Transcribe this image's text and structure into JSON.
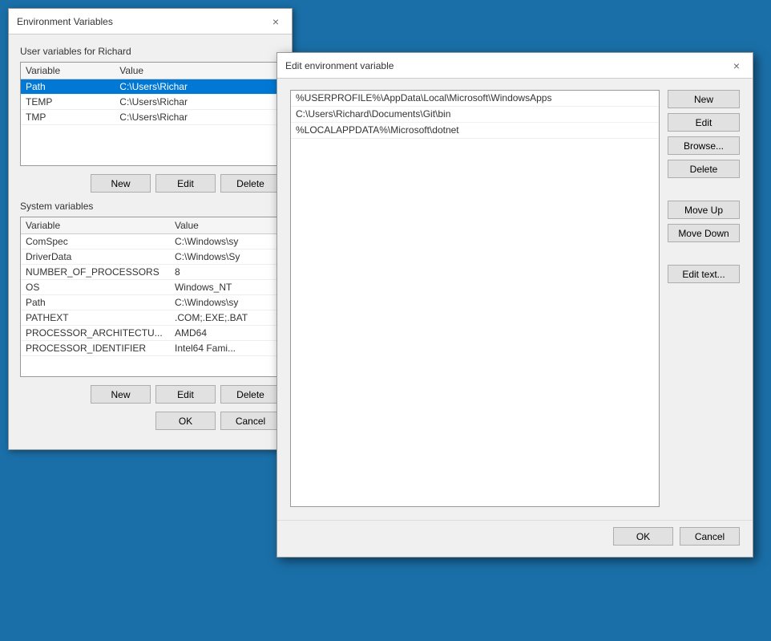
{
  "desktop": {
    "background_color": "#1a6fa8"
  },
  "env_dialog": {
    "title": "Environment Variables",
    "close_label": "×",
    "user_section_label": "User variables for Richard",
    "user_table": {
      "headers": [
        "Variable",
        "Value"
      ],
      "rows": [
        {
          "variable": "Path",
          "value": "C:\\Users\\Richar",
          "selected": true
        },
        {
          "variable": "TEMP",
          "value": "C:\\Users\\Richar"
        },
        {
          "variable": "TMP",
          "value": "C:\\Users\\Richar"
        }
      ]
    },
    "user_buttons": [
      {
        "label": "New",
        "name": "user-new-button"
      },
      {
        "label": "Edit",
        "name": "user-edit-button"
      },
      {
        "label": "Delete",
        "name": "user-delete-button"
      }
    ],
    "system_section_label": "System variables",
    "system_table": {
      "headers": [
        "Variable",
        "Value"
      ],
      "rows": [
        {
          "variable": "ComSpec",
          "value": "C:\\Windows\\sy"
        },
        {
          "variable": "DriverData",
          "value": "C:\\Windows\\Sy"
        },
        {
          "variable": "NUMBER_OF_PROCESSORS",
          "value": "8"
        },
        {
          "variable": "OS",
          "value": "Windows_NT"
        },
        {
          "variable": "Path",
          "value": "C:\\Windows\\sy"
        },
        {
          "variable": "PATHEXT",
          "value": ".COM;.EXE;.BAT"
        },
        {
          "variable": "PROCESSOR_ARCHITECTU...",
          "value": "AMD64"
        },
        {
          "variable": "PROCESSOR_IDENTIFIER",
          "value": "Intel64 Fami..."
        }
      ]
    },
    "system_buttons": [
      {
        "label": "New",
        "name": "sys-new-button"
      },
      {
        "label": "Edit",
        "name": "sys-edit-button"
      },
      {
        "label": "Delete",
        "name": "sys-delete-button"
      }
    ],
    "footer_buttons": [
      {
        "label": "OK",
        "name": "env-ok-button"
      },
      {
        "label": "Cancel",
        "name": "env-cancel-button"
      }
    ]
  },
  "edit_dialog": {
    "title": "Edit environment variable",
    "close_label": "×",
    "path_entries": [
      {
        "value": "%USERPROFILE%\\AppData\\Local\\Microsoft\\WindowsApps",
        "selected": false
      },
      {
        "value": "C:\\Users\\Richard\\Documents\\Git\\bin",
        "selected": false
      },
      {
        "value": "%LOCALAPPDATA%\\Microsoft\\dotnet",
        "selected": false
      }
    ],
    "buttons": [
      {
        "label": "New",
        "name": "edit-new-button"
      },
      {
        "label": "Edit",
        "name": "edit-edit-button"
      },
      {
        "label": "Browse...",
        "name": "edit-browse-button"
      },
      {
        "label": "Delete",
        "name": "edit-delete-button"
      },
      {
        "label": "Move Up",
        "name": "edit-move-up-button"
      },
      {
        "label": "Move Down",
        "name": "edit-move-down-button"
      },
      {
        "label": "Edit text...",
        "name": "edit-text-button"
      }
    ],
    "footer_buttons": [
      {
        "label": "OK",
        "name": "edit-ok-button"
      },
      {
        "label": "Cancel",
        "name": "edit-cancel-button"
      }
    ]
  }
}
